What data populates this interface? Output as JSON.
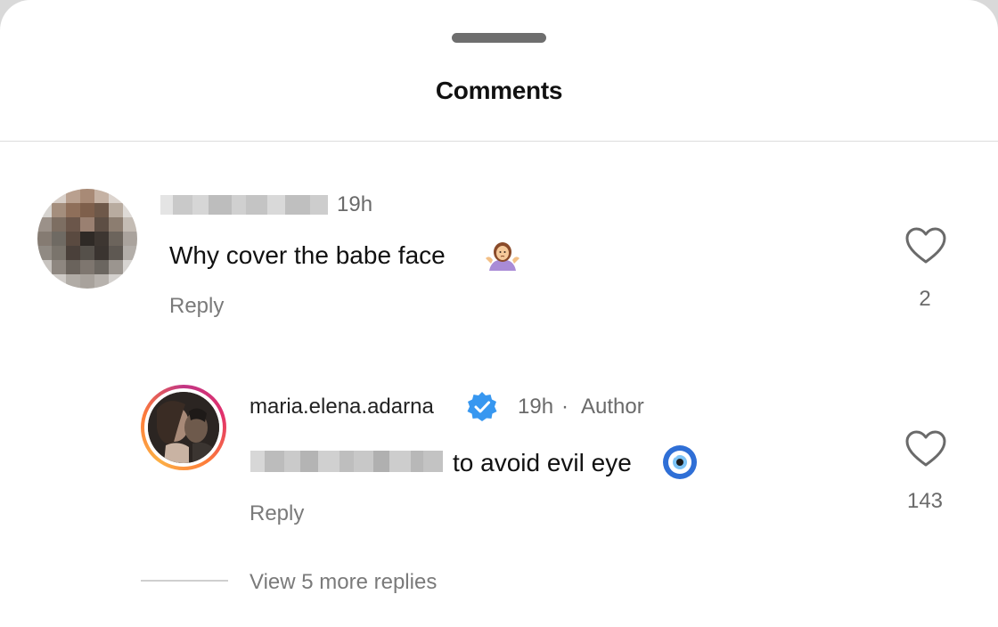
{
  "sheet": {
    "title": "Comments"
  },
  "comments": [
    {
      "username_hidden": true,
      "time": "19h",
      "text": "Why cover the babe face",
      "emoji": "person-shrugging-emoji",
      "reply_label": "Reply",
      "like_count": "2"
    }
  ],
  "reply": {
    "username": "maria.elena.adarna",
    "verified": true,
    "time": "19h",
    "separator": "·",
    "author_tag": "Author",
    "mention_hidden": true,
    "text": "to avoid evil eye",
    "emoji": "nazar-amulet-emoji",
    "reply_label": "Reply",
    "like_count": "143"
  },
  "thread": {
    "view_more_label": "View 5 more replies"
  },
  "colors": {
    "verified_badge": "#3797f0",
    "story_ring_start": "#c13584",
    "story_ring_end": "#fcaf45"
  }
}
